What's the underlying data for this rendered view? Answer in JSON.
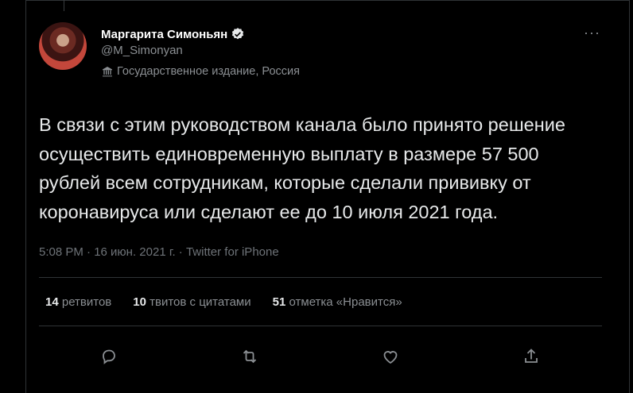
{
  "author": {
    "name": "Маргарита Симоньян",
    "handle": "@M_Simonyan",
    "label": "Государственное издание, Россия"
  },
  "tweet": {
    "text": "В связи с этим руководством канала было принято решение осуществить единовременную выплату в размере 57 500 рублей всем сотрудникам, которые сделали прививку от коронавируса или сделают ее до 10 июля 2021 года.",
    "meta": "5:08 PM · 16 июн. 2021 г. · Twitter for iPhone"
  },
  "stats": {
    "retweets_count": "14",
    "retweets_label": "ретвитов",
    "quotes_count": "10",
    "quotes_label": "твитов с цитатами",
    "likes_count": "51",
    "likes_label": "отметка «Нравится»"
  },
  "icons": {
    "more": "more-icon",
    "verified": "verified-badge-icon",
    "label": "government-label-icon",
    "reply": "reply-icon",
    "retweet": "retweet-icon",
    "like": "heart-icon",
    "share": "share-icon"
  },
  "colors": {
    "background": "#000000",
    "text": "#e7e9ea",
    "muted": "#8b8f93"
  }
}
